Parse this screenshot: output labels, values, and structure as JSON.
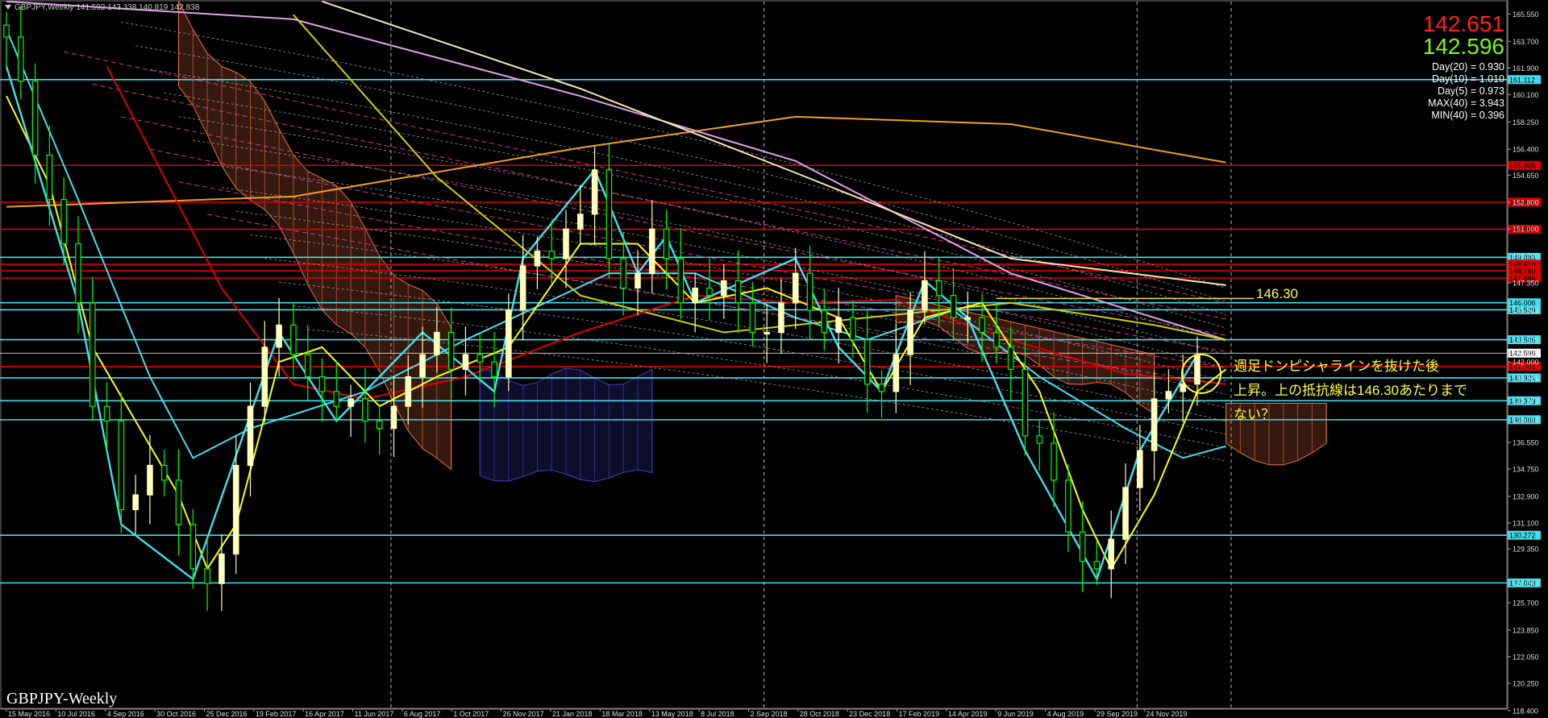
{
  "header": {
    "symbol_line": "GBPJPY,Weekly  141.592 143.338 140.819 142.838"
  },
  "prices": {
    "bid": "142.651",
    "ask": "142.596"
  },
  "stats": [
    "Day(20) = 0.930",
    "Day(10) = 1.010",
    "Day(5) = 0.973",
    "MAX(40) = 3.943",
    "MIN(40) = 0.396"
  ],
  "watermark": "GBPJPY-Weekly",
  "annotations": {
    "level": "146.30",
    "note_line1": "週足ドンピシャラインを抜けた後",
    "note_line2": "上昇。上の抵抗線は146.30あたりまで",
    "note_line3": "ない？"
  },
  "colors": {
    "bg": "#000000",
    "bull": "#ffffb0",
    "bear": "#00ff00",
    "cyan": "#40e0f0",
    "red": "#e00000",
    "orange": "#f0a020",
    "violet": "#e0a0e8"
  },
  "chart_data": {
    "type": "line",
    "title": "GBPJPY-Weekly",
    "ylim": [
      118.5,
      166.5
    ],
    "y_ticks": [
      "165.550",
      "163.700",
      "161.900",
      "160.100",
      "158.250",
      "156.400",
      "154.650",
      "152.800",
      "151.000",
      "149.200",
      "147.350",
      "145.529",
      "143.505",
      "142.596",
      "142.000",
      "140.921",
      "139.373",
      "138.088",
      "136.550",
      "134.750",
      "132.900",
      "131.100",
      "129.350",
      "127.043",
      "125.700",
      "123.850",
      "122.050",
      "120.250",
      "118.400"
    ],
    "x_ticks": [
      "15 May 2016",
      "10 Jul 2016",
      "4 Sep 2016",
      "30 Oct 2016",
      "25 Dec 2016",
      "19 Feb 2017",
      "16 Apr 2017",
      "11 Jun 2017",
      "6 Aug 2017",
      "1 Oct 2017",
      "26 Nov 2017",
      "21 Jan 2018",
      "18 Mar 2018",
      "13 May 2018",
      "8 Jul 2018",
      "2 Sep 2018",
      "28 Oct 2018",
      "23 Dec 2018",
      "17 Feb 2019",
      "14 Apr 2019",
      "9 Jun 2019",
      "4 Aug 2019",
      "29 Sep 2019",
      "24 Nov 2019"
    ],
    "horizontal_lines": [
      {
        "price": 161.112,
        "label": "161.112",
        "color": "#40e0f0"
      },
      {
        "price": 155.305,
        "label": "155.305",
        "color": "#e00000"
      },
      {
        "price": 152.816,
        "label": "152.816",
        "color": "#e00000"
      },
      {
        "price": 150.981,
        "label": "150.981",
        "color": "#e00000"
      },
      {
        "price": 149.083,
        "label": "149.083",
        "color": "#40e0f0"
      },
      {
        "price": 148.61,
        "label": "148.610",
        "color": "#e00000"
      },
      {
        "price": 148.18,
        "label": "148.180",
        "color": "#e00000"
      },
      {
        "price": 147.686,
        "label": "147.686",
        "color": "#e00000"
      },
      {
        "price": 146.006,
        "label": "146.006",
        "color": "#40e0f0"
      },
      {
        "price": 145.529,
        "label": "145.529",
        "color": "#40e0f0"
      },
      {
        "price": 143.505,
        "label": "143.505",
        "color": "#40e0f0"
      },
      {
        "price": 142.596,
        "label": "142.596",
        "color": "#ffffff"
      },
      {
        "price": 141.701,
        "label": "141.701",
        "color": "#e00000"
      },
      {
        "price": 140.921,
        "label": "140.921",
        "color": "#40e0f0"
      },
      {
        "price": 139.373,
        "label": "139.373",
        "color": "#40e0f0"
      },
      {
        "price": 138.088,
        "label": "138.088",
        "color": "#40e0f0"
      },
      {
        "price": 130.272,
        "label": "130.272",
        "color": "#40e0f0"
      },
      {
        "price": 127.043,
        "label": "127.043",
        "color": "#40e0f0"
      }
    ],
    "close_path": [
      [
        0,
        164
      ],
      [
        1,
        161
      ],
      [
        2,
        156
      ],
      [
        3,
        153
      ],
      [
        4,
        150
      ],
      [
        5,
        146
      ],
      [
        6,
        139
      ],
      [
        7,
        138
      ],
      [
        8,
        132
      ],
      [
        9,
        133
      ],
      [
        10,
        135
      ],
      [
        11,
        134
      ],
      [
        12,
        131
      ],
      [
        13,
        128
      ],
      [
        14,
        127
      ],
      [
        15,
        129
      ],
      [
        16,
        135
      ],
      [
        17,
        139
      ],
      [
        18,
        143
      ],
      [
        19,
        144.5
      ],
      [
        20,
        142.5
      ],
      [
        21,
        141
      ],
      [
        22,
        140
      ],
      [
        23,
        139
      ],
      [
        24,
        139.5
      ],
      [
        25,
        138
      ],
      [
        26,
        137.5
      ],
      [
        27,
        139
      ],
      [
        28,
        141
      ],
      [
        29,
        142.5
      ],
      [
        30,
        144
      ],
      [
        31,
        141.5
      ],
      [
        32,
        142.5
      ],
      [
        33,
        142
      ],
      [
        34,
        141
      ],
      [
        35,
        145.5
      ],
      [
        36,
        148.5
      ],
      [
        37,
        149.5
      ],
      [
        38,
        149
      ],
      [
        39,
        151
      ],
      [
        40,
        152
      ],
      [
        41,
        155
      ],
      [
        42,
        149
      ],
      [
        43,
        147
      ],
      [
        44,
        148
      ],
      [
        45,
        151
      ],
      [
        46,
        149
      ],
      [
        47,
        146
      ],
      [
        48,
        147
      ],
      [
        49,
        146.5
      ],
      [
        50,
        147.5
      ],
      [
        51,
        146
      ],
      [
        52,
        144
      ],
      [
        53,
        144
      ],
      [
        54,
        146
      ],
      [
        55,
        148
      ],
      [
        56,
        145.5
      ],
      [
        57,
        144
      ],
      [
        58,
        145
      ],
      [
        59,
        143.5
      ],
      [
        60,
        140.5
      ],
      [
        61,
        140
      ],
      [
        62,
        142.5
      ],
      [
        63,
        145.5
      ],
      [
        64,
        147.5
      ],
      [
        65,
        146.5
      ],
      [
        66,
        145
      ],
      [
        67,
        145
      ],
      [
        68,
        144
      ],
      [
        69,
        143
      ],
      [
        70,
        141.5
      ],
      [
        71,
        137
      ],
      [
        72,
        136.5
      ],
      [
        73,
        134
      ],
      [
        74,
        130.5
      ],
      [
        75,
        128.5
      ],
      [
        76,
        128
      ],
      [
        77,
        130
      ],
      [
        78,
        133.5
      ],
      [
        79,
        136
      ],
      [
        80,
        139.5
      ],
      [
        81,
        140
      ],
      [
        82,
        140.5
      ],
      [
        83,
        142.5
      ]
    ],
    "series": [
      {
        "name": "",
        "color": "#f0a020",
        "values": [
          [
            0,
            152.5
          ],
          [
            20,
            153.2
          ],
          [
            40,
            156.5
          ],
          [
            55,
            158.6
          ],
          [
            70,
            158.1
          ],
          [
            85,
            155.5
          ]
        ]
      },
      {
        "name": "",
        "color": "#e0a0e8",
        "values": [
          [
            0,
            166.4
          ],
          [
            20,
            165.2
          ],
          [
            40,
            160.0
          ],
          [
            55,
            155.6
          ],
          [
            70,
            148.0
          ],
          [
            85,
            143.5
          ]
        ]
      },
      {
        "name": "",
        "color": "#f0e6b0",
        "values": [
          [
            22,
            166.4
          ],
          [
            40,
            160.5
          ],
          [
            55,
            154.8
          ],
          [
            70,
            149.0
          ],
          [
            85,
            147.2
          ]
        ]
      },
      {
        "name": "",
        "color": "#d0d000",
        "values": [
          [
            20,
            165.5
          ],
          [
            30,
            154.5
          ],
          [
            40,
            146.5
          ],
          [
            50,
            144.0
          ],
          [
            60,
            145.0
          ],
          [
            70,
            146.0
          ],
          [
            80,
            144.5
          ],
          [
            85,
            143.5
          ]
        ]
      },
      {
        "name": "",
        "color": "#e00000",
        "values": [
          [
            7,
            162
          ],
          [
            15,
            147
          ],
          [
            20,
            140.5
          ],
          [
            25,
            139.5
          ],
          [
            32,
            141
          ],
          [
            40,
            144
          ],
          [
            48,
            146.5
          ],
          [
            55,
            146
          ],
          [
            62,
            146.2
          ],
          [
            70,
            143.5
          ],
          [
            78,
            141.2
          ],
          [
            85,
            140.5
          ]
        ]
      },
      {
        "name": "",
        "color": "#40e0f0",
        "values": [
          [
            0,
            164.5
          ],
          [
            5,
            153
          ],
          [
            10,
            141
          ],
          [
            13,
            135.5
          ],
          [
            17,
            137.5
          ],
          [
            25,
            140
          ],
          [
            32,
            143.5
          ],
          [
            42,
            148
          ],
          [
            48,
            148
          ],
          [
            55,
            145
          ],
          [
            60,
            143.5
          ],
          [
            66,
            145.5
          ],
          [
            72,
            141
          ],
          [
            78,
            137.5
          ],
          [
            82,
            135.5
          ],
          [
            85,
            136.3
          ]
        ]
      },
      {
        "name": "",
        "color": "#ffff00",
        "values": [
          [
            0,
            160
          ],
          [
            3,
            154
          ],
          [
            6,
            143
          ],
          [
            9,
            138
          ],
          [
            12,
            133
          ],
          [
            14,
            128
          ],
          [
            16,
            131
          ],
          [
            19,
            142
          ],
          [
            22,
            143
          ],
          [
            26,
            139
          ],
          [
            30,
            141
          ],
          [
            35,
            143
          ],
          [
            40,
            150
          ],
          [
            44,
            150
          ],
          [
            48,
            146
          ],
          [
            53,
            147
          ],
          [
            58,
            145
          ],
          [
            61,
            140
          ],
          [
            64,
            145
          ],
          [
            68,
            146
          ],
          [
            72,
            140
          ],
          [
            75,
            132
          ],
          [
            77,
            128
          ],
          [
            80,
            133
          ],
          [
            83,
            140
          ],
          [
            85,
            141.5
          ]
        ]
      }
    ]
  }
}
